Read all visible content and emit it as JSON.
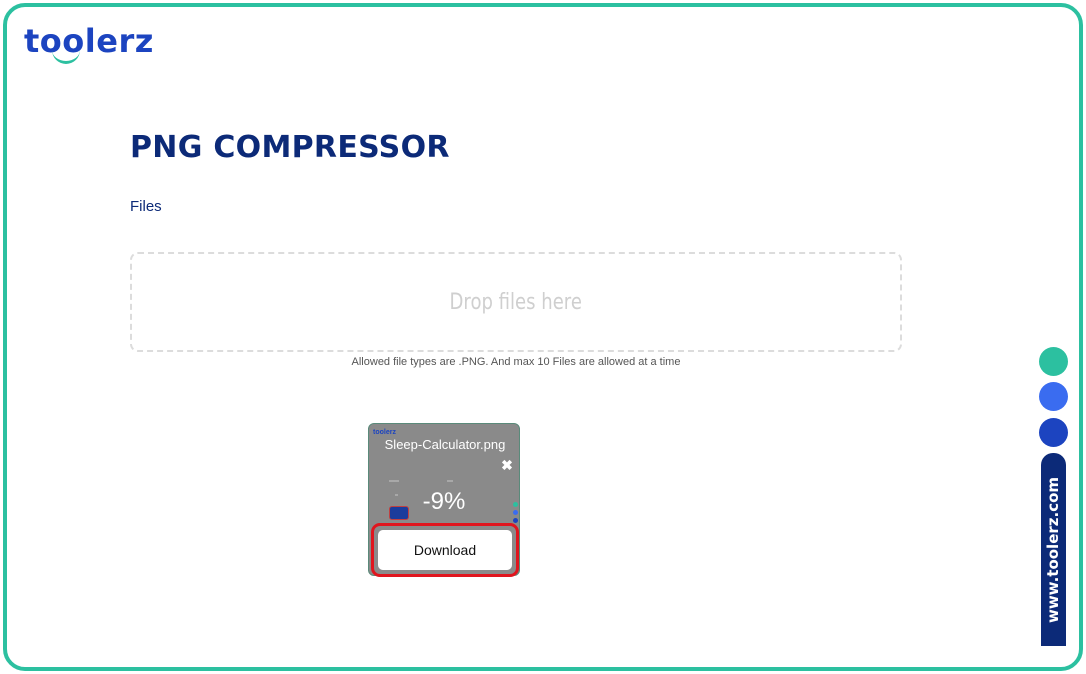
{
  "brand": {
    "logo_text": "toolerz",
    "side_url": "www.toolerz.com"
  },
  "page": {
    "title": "PNG COMPRESSOR",
    "files_label": "Files",
    "dropzone_text": "Drop files here",
    "allowed_note": "Allowed file types are .PNG. And max 10 Files are allowed at a time"
  },
  "file_card": {
    "file_name": "Sleep-Calculator.png",
    "compression_ratio": "-9%",
    "download_label": "Download",
    "remove_icon": "close-icon"
  },
  "colors": {
    "accent_teal": "#2cc0a0",
    "brand_blue": "#1c44c0",
    "navy": "#0c2a78",
    "highlight_red": "#e0151e"
  },
  "side_dots": [
    "#2cc0a0",
    "#3a6cf0",
    "#1c44c0"
  ]
}
